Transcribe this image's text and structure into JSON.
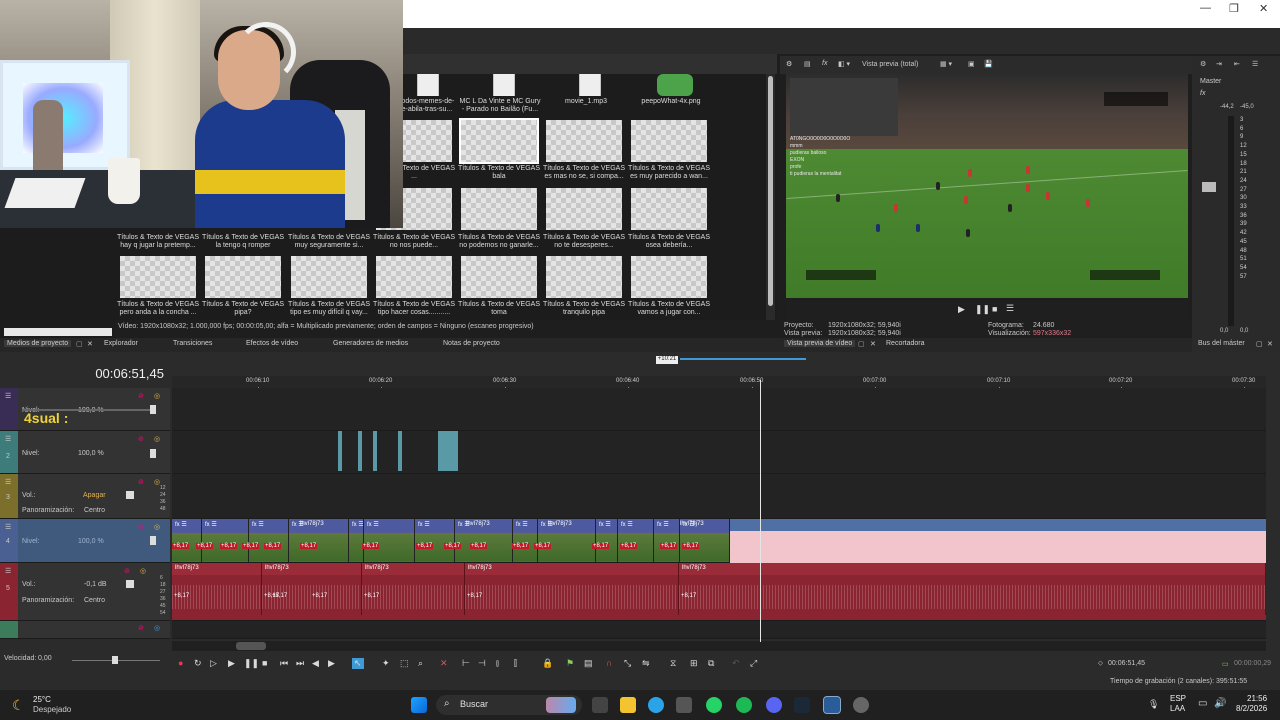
{
  "window": {
    "minimize": "—",
    "restore": "❐",
    "close": "✕"
  },
  "media": {
    "top_row": [
      "...todos-memes-de-\n...e-abila-tras-su...",
      "MC L Da Vinte e MC Gury\n- Parado no Bailão (Fu...",
      "movie_1.mp3",
      "peepoWhat-4x.png"
    ],
    "row2": [
      "Títulos & Texto de VEGAS\n...",
      "Títulos & Texto de VEGAS\nbala",
      "Títulos & Texto de VEGAS\nes mas no se, si compa...",
      "Títulos & Texto de VEGAS\nes muy parecido a wan..."
    ],
    "row3": [
      "Títulos & Texto de VEGAS\nhay q jugar la pretemp...",
      "Títulos & Texto de VEGAS\nla tengo q romper",
      "Títulos & Texto de VEGAS\nmuy seguramente si...",
      "Títulos & Texto de VEGAS\nno nos puede...",
      "Títulos & Texto de VEGAS\nno podemos no ganarle...",
      "Títulos & Texto de VEGAS\nno te desesperes...",
      "Títulos & Texto de VEGAS\nosea debería..."
    ],
    "row4": [
      "Títulos & Texto de VEGAS\npero anda a la concha ...",
      "Títulos & Texto de VEGAS\npipa?",
      "Títulos & Texto de VEGAS\ntipo es muy difícil q vay...",
      "Títulos & Texto de VEGAS\ntipo hacer cosas...........",
      "Títulos & Texto de VEGAS\ntoma",
      "Títulos & Texto de VEGAS\ntranquilo pipa",
      "Títulos & Texto de VEGAS\nvamos a jugar con..."
    ],
    "info": "Vídeo: 1920x1080x32; 1.000,000 fps; 00:00:05,00; alfa = Multiplicado previamente; orden de campos = Ninguno (escaneo progresivo)"
  },
  "tabs": [
    "Medios de proyecto",
    "Explorador",
    "Transiciones",
    "Efectos de vídeo",
    "Generadores de medios",
    "Notas de proyecto"
  ],
  "preview": {
    "mode": "Vista previa (total)",
    "proyecto_label": "Proyecto:",
    "proyecto": "1920x1080x32; 59,940i",
    "vista_label": "Vista previa:",
    "vista": "1920x1080x32; 59,940i",
    "fotograma_label": "Fotograma:",
    "fotograma": "24.680",
    "visual_label": "Visualización:",
    "visual": "597x336x32",
    "tabs": [
      "Vista previa de vídeo",
      "Recortadora"
    ],
    "chat": [
      "AT0NGO0O0O0O0O0O0O",
      "mmm",
      "pudieras bailoso",
      "EXON",
      "profe",
      "ti pudieras la mentalitat"
    ]
  },
  "master": {
    "title": "Master",
    "tab": "Bus del máster",
    "peak_l": "-44,2",
    "peak_r": "-45,0",
    "scale": [
      "3",
      "6",
      "9",
      "12",
      "15",
      "18",
      "21",
      "24",
      "27",
      "30",
      "33",
      "36",
      "39",
      "42",
      "45",
      "48",
      "51",
      "54",
      "57"
    ],
    "bottom_l": "0,0",
    "bottom_r": "0,0"
  },
  "timeline": {
    "time": "00:06:51,45",
    "marker": "+10:21",
    "ruler": [
      "00:06:10",
      "00:06:20",
      "00:06:30",
      "00:06:40",
      "00:06:50",
      "00:07:00",
      "00:07:10",
      "00:07:20",
      "00:07:30"
    ],
    "tracks": [
      {
        "num": "1",
        "nivel_label": "Nivel:",
        "nivel": "100,0 %",
        "overlay": "4sual :"
      },
      {
        "num": "2",
        "nivel_label": "Nivel:",
        "nivel": "100,0 %"
      },
      {
        "num": "3",
        "vol_label": "Vol.:",
        "vol": "Apagar",
        "pan_label": "Panoramización:",
        "pan": "Centro"
      },
      {
        "num": "4",
        "nivel_label": "Nivel:",
        "nivel": "100,0 %"
      },
      {
        "num": "5",
        "vol_label": "Vol.:",
        "vol": "-0,1 dB",
        "pan_label": "Panoramización:",
        "pan": "Centro"
      }
    ],
    "clip_name": "lhvl78j73",
    "gain": "+8,17",
    "velocidad_label": "Velocidad:",
    "velocidad": "0,00",
    "cursor_time": "00:06:51,45",
    "end_time": "00:00:00,29",
    "record": "Tiempo de grabación (2 canales): 395:51:55",
    "meter_scale": [
      "12",
      "24",
      "36",
      "48"
    ],
    "meter_scale5": [
      "6",
      "18",
      "27",
      "36",
      "45",
      "54"
    ]
  },
  "taskbar": {
    "temp": "25°C",
    "weather": "Despejado",
    "search": "Buscar",
    "lang1": "ESP",
    "lang2": "LAA",
    "time": "21:56",
    "date": "8/2/2026"
  },
  "colors": {
    "video_track": "#585892",
    "audio_track": "#8b2431",
    "selection": "#f2c4cc",
    "accent": "#3f9ad6"
  }
}
